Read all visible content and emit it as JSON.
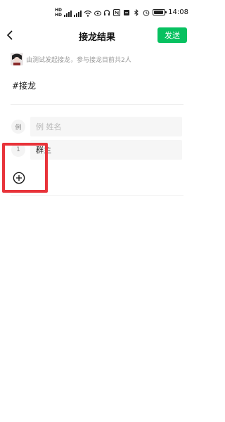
{
  "status_bar": {
    "time": "14:08",
    "sim1_label": "HD",
    "sim2_label": "HD",
    "icons": [
      "signal-icon",
      "wifi-icon",
      "headphones-icon",
      "nfc-icon",
      "mute-icon",
      "bluetooth-icon",
      "alarm-icon",
      "battery-icon"
    ],
    "battery_level": 0.8
  },
  "header": {
    "title": "接龙结果",
    "send_label": "发送",
    "back_icon": "chevron-left-icon",
    "accent_color": "#07c160"
  },
  "info": {
    "text": "由测试发起接龙，参与接龙目前共2人"
  },
  "topic": "#接龙",
  "entries": [
    {
      "index": "例",
      "text": "例 姓名",
      "is_placeholder": true
    },
    {
      "index": "1",
      "text": "群主",
      "is_placeholder": false
    }
  ],
  "add_button": {
    "icon": "plus-circle-icon",
    "highlight_color": "#e8333a"
  }
}
